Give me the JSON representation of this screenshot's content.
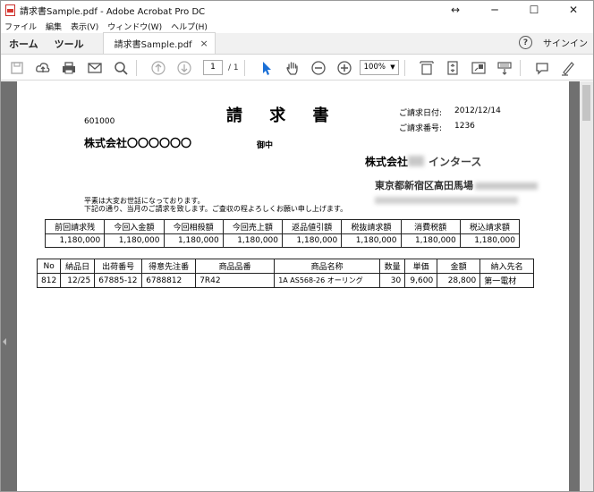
{
  "titlebar": {
    "title": "請求書Sample.pdf - Adobe Acrobat Pro DC",
    "buttons": [
      "↔",
      "─",
      "☐",
      "✕"
    ]
  },
  "menus": [
    "ファイル",
    "編集",
    "表示(V)",
    "ウィンドウ(W)",
    "ヘルプ(H)"
  ],
  "tabs": {
    "home": "ホーム",
    "tools": "ツール",
    "document": "請求書Sample.pdf",
    "close": "×",
    "signin": "サインイン",
    "help": "?"
  },
  "toolbar": {
    "page_current": "1",
    "page_total": "/ 1",
    "zoom": "100%"
  },
  "invoice": {
    "title": "請 求 書",
    "customer_code": "601000",
    "customer_name": "株式会社〇〇〇〇〇〇",
    "honorific": "御中",
    "date_label": "ご請求日付:",
    "date_value": "2012/12/14",
    "number_label": "ご請求番号:",
    "number_value": "1236",
    "company_prefix": "株式会社",
    "company_suffix": "インタース",
    "company_address": "東京都新宿区高田馬場",
    "greeting1": "平素は大変お世話になっております。",
    "greeting2": "下記の通り、当月のご請求を致します。ご査収の程よろしくお願い申し上げます。",
    "summary_headers": [
      "前回請求残",
      "今回入金額",
      "今回相殺額",
      "今回売上額",
      "返品値引額",
      "税抜請求額",
      "消費税額",
      "税込請求額"
    ],
    "summary_values": [
      "1,180,000",
      "1,180,000",
      "1,180,000",
      "1,180,000",
      "1,180,000",
      "1,180,000",
      "1,180,000",
      "1,180,000"
    ],
    "detail_headers": [
      "No",
      "納品日",
      "出荷番号",
      "得意先注番",
      "商品品番",
      "商品名称",
      "数量",
      "単価",
      "金額",
      "納入先名"
    ],
    "detail_rows": [
      [
        "812",
        "12/25",
        "67885-12",
        "6788812",
        "7R42",
        "1A AS568-26 オーリング",
        "30",
        "9,600",
        "28,800",
        "第一電材"
      ]
    ]
  }
}
